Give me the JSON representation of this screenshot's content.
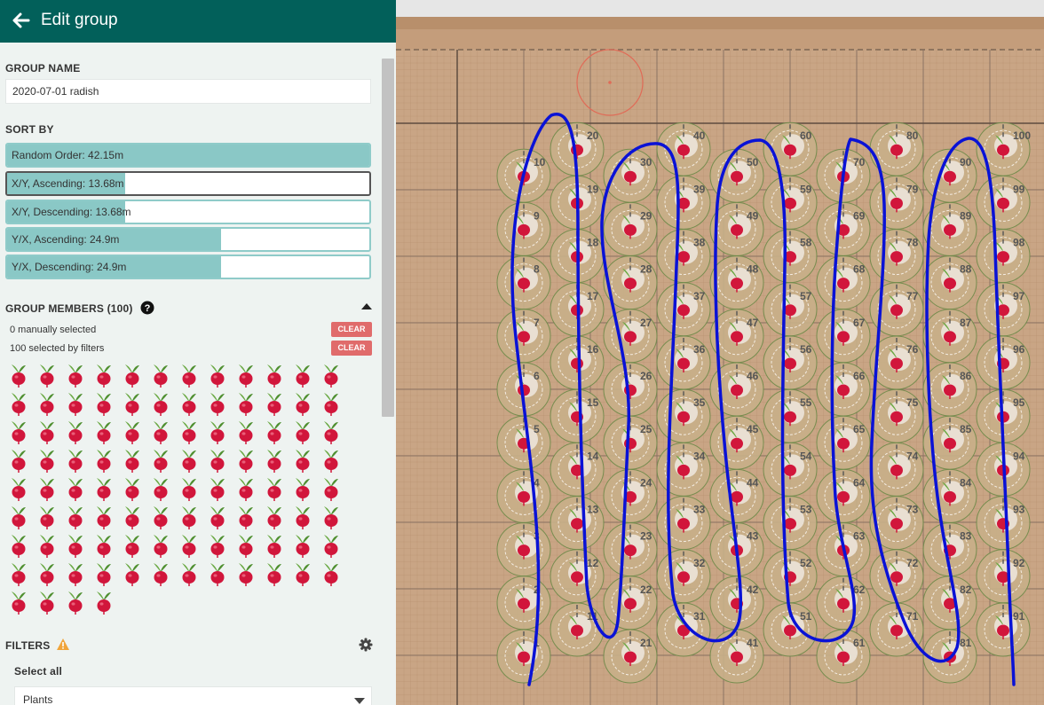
{
  "header": {
    "title": "Edit group"
  },
  "group_name": {
    "label": "GROUP NAME",
    "value": "2020-07-01 radish"
  },
  "sort": {
    "label": "SORT BY",
    "options": [
      {
        "label": "Random Order: 42.15m",
        "fill": 1.0,
        "selected": false
      },
      {
        "label": "X/Y, Ascending: 13.68m",
        "fill": 0.325,
        "selected": true
      },
      {
        "label": "X/Y, Descending: 13.68m",
        "fill": 0.325,
        "selected": false
      },
      {
        "label": "Y/X, Ascending: 24.9m",
        "fill": 0.59,
        "selected": false
      },
      {
        "label": "Y/X, Descending: 24.9m",
        "fill": 0.59,
        "selected": false
      }
    ]
  },
  "members": {
    "label": "GROUP MEMBERS (100)",
    "manual_text": "0 manually selected",
    "filter_text": "100 selected by filters",
    "clear_label": "CLEAR",
    "count": 100,
    "plant_icon": "radish-icon"
  },
  "filters": {
    "label": "FILTERS",
    "select_all": "Select all",
    "type_value": "Plants"
  },
  "colors": {
    "header": "#02605a",
    "sort_fill": "#8ac8c6",
    "clear": "#e06b6b",
    "path": "#0a12d6",
    "soil": "#c9a585"
  },
  "map": {
    "columns": [
      {
        "labels": [
          "10",
          "9",
          "8",
          "7",
          "6",
          "5",
          "4",
          "3",
          "2",
          "1"
        ]
      },
      {
        "labels": [
          "20",
          "19",
          "18",
          "17",
          "16",
          "15",
          "14",
          "13",
          "12",
          "11"
        ]
      },
      {
        "labels": [
          "30",
          "29",
          "28",
          "27",
          "26",
          "25",
          "24",
          "23",
          "22",
          "21"
        ]
      },
      {
        "labels": [
          "40",
          "39",
          "38",
          "37",
          "36",
          "35",
          "34",
          "33",
          "32",
          "31"
        ]
      },
      {
        "labels": [
          "50",
          "49",
          "48",
          "47",
          "46",
          "45",
          "44",
          "43",
          "42",
          "41"
        ]
      },
      {
        "labels": [
          "60",
          "59",
          "58",
          "57",
          "56",
          "55",
          "54",
          "53",
          "52",
          "51"
        ]
      },
      {
        "labels": [
          "70",
          "69",
          "68",
          "67",
          "66",
          "65",
          "64",
          "63",
          "62",
          "61"
        ]
      },
      {
        "labels": [
          "80",
          "79",
          "78",
          "77",
          "76",
          "75",
          "74",
          "73",
          "72",
          "71"
        ]
      },
      {
        "labels": [
          "90",
          "89",
          "88",
          "87",
          "86",
          "85",
          "84",
          "83",
          "82",
          "81"
        ]
      },
      {
        "labels": [
          "100",
          "99",
          "98",
          "97",
          "96",
          "95",
          "94",
          "93",
          "92",
          "91"
        ]
      }
    ]
  }
}
